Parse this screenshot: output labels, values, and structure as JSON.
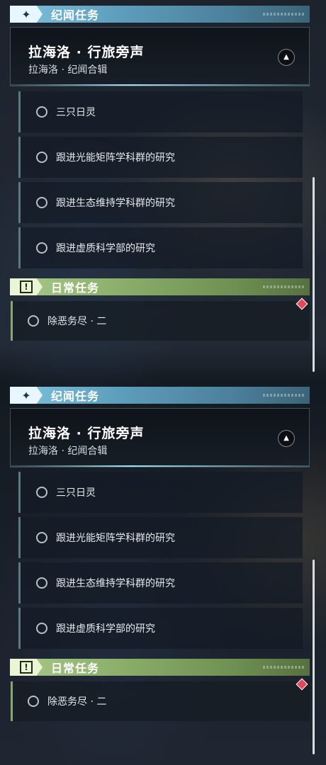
{
  "panels": [
    {
      "story_header": {
        "title": "纪闻任务",
        "icon": "four-point-star-icon"
      },
      "quest": {
        "title": "拉海洛 · 行旅旁声",
        "subtitle": "拉海洛 · 纪闻合辑"
      },
      "subtasks": [
        {
          "label": "三只日灵"
        },
        {
          "label": "跟进光能矩阵学科群的研究"
        },
        {
          "label": "跟进生态维持学科群的研究"
        },
        {
          "label": "跟进虚质科学部的研究"
        }
      ],
      "daily_header": {
        "title": "日常任务",
        "icon": "exclamation-box-icon"
      },
      "daily_items": [
        {
          "label": "除恶务尽 · 二"
        }
      ]
    },
    {
      "story_header": {
        "title": "纪闻任务",
        "icon": "four-point-star-icon"
      },
      "quest": {
        "title": "拉海洛 · 行旅旁声",
        "subtitle": "拉海洛 · 纪闻合辑"
      },
      "subtasks": [
        {
          "label": "三只日灵"
        },
        {
          "label": "跟进光能矩阵学科群的研究"
        },
        {
          "label": "跟进生态维持学科群的研究"
        },
        {
          "label": "跟进虚质科学部的研究"
        }
      ],
      "daily_header": {
        "title": "日常任务",
        "icon": "exclamation-box-icon"
      },
      "daily_items": [
        {
          "label": "除恶务尽 · 二"
        }
      ]
    }
  ],
  "colors": {
    "story_accent": "#7fc2de",
    "daily_accent": "#a9c98a",
    "alert_marker": "#e0485c"
  }
}
